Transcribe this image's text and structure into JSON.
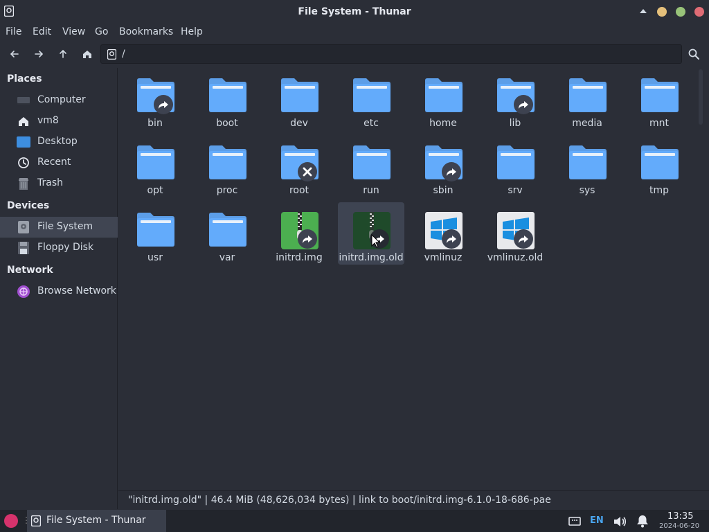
{
  "window": {
    "title": "File System - Thunar"
  },
  "colors": {
    "folder": "#5c9ee8",
    "accent": "#4aa6f0",
    "close": "#e06c75",
    "maximize": "#98c379",
    "minimize": "#e5c07b"
  },
  "menu": [
    "File",
    "Edit",
    "View",
    "Go",
    "Bookmarks",
    "Help"
  ],
  "location": {
    "path": "/"
  },
  "sidebar": {
    "places_header": "Places",
    "places": [
      {
        "label": "Computer",
        "icon": "computer-icon"
      },
      {
        "label": "vm8",
        "icon": "home-icon"
      },
      {
        "label": "Desktop",
        "icon": "desktop-icon"
      },
      {
        "label": "Recent",
        "icon": "clock-icon"
      },
      {
        "label": "Trash",
        "icon": "trash-icon"
      }
    ],
    "devices_header": "Devices",
    "devices": [
      {
        "label": "File System",
        "icon": "drive-icon",
        "active": true
      },
      {
        "label": "Floppy Disk",
        "icon": "floppy-icon"
      }
    ],
    "network_header": "Network",
    "network": [
      {
        "label": "Browse Network",
        "icon": "network-icon"
      }
    ]
  },
  "files": [
    {
      "name": "bin",
      "type": "folder",
      "emblem": "symlink"
    },
    {
      "name": "boot",
      "type": "folder"
    },
    {
      "name": "dev",
      "type": "folder"
    },
    {
      "name": "etc",
      "type": "folder"
    },
    {
      "name": "home",
      "type": "folder"
    },
    {
      "name": "lib",
      "type": "folder",
      "emblem": "symlink"
    },
    {
      "name": "media",
      "type": "folder"
    },
    {
      "name": "mnt",
      "type": "folder"
    },
    {
      "name": "opt",
      "type": "folder"
    },
    {
      "name": "proc",
      "type": "folder"
    },
    {
      "name": "root",
      "type": "folder",
      "emblem": "unreadable"
    },
    {
      "name": "run",
      "type": "folder"
    },
    {
      "name": "sbin",
      "type": "folder",
      "emblem": "symlink"
    },
    {
      "name": "srv",
      "type": "folder"
    },
    {
      "name": "sys",
      "type": "folder"
    },
    {
      "name": "tmp",
      "type": "folder"
    },
    {
      "name": "usr",
      "type": "folder"
    },
    {
      "name": "var",
      "type": "folder"
    },
    {
      "name": "initrd.img",
      "type": "archive",
      "emblem": "symlink"
    },
    {
      "name": "initrd.img.old",
      "type": "archive",
      "emblem": "symlink",
      "selected": true
    },
    {
      "name": "vmlinuz",
      "type": "kernel",
      "emblem": "symlink"
    },
    {
      "name": "vmlinuz.old",
      "type": "kernel",
      "emblem": "symlink"
    }
  ],
  "status": {
    "text": "\"initrd.img.old\"  |  46.4 MiB (48,626,034 bytes)  |  link to boot/initrd.img-6.1.0-18-686-pae"
  },
  "taskbar": {
    "window_label": "File System - Thunar",
    "separator": "⋮",
    "lang": "EN",
    "time": "13:35",
    "date": "2024-06-20"
  }
}
